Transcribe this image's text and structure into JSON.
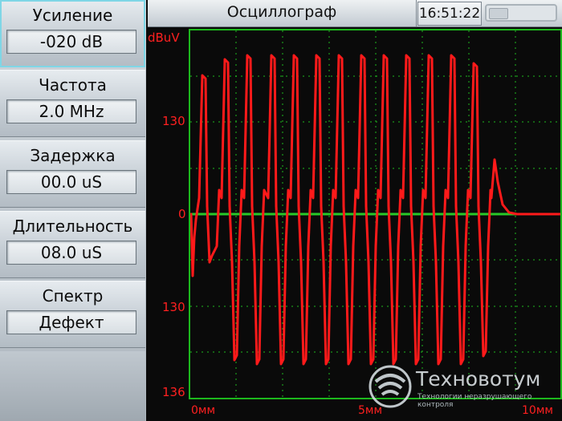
{
  "topbar": {
    "title": "Осциллограф",
    "time": "16:51:22",
    "battery_icon": "battery-icon"
  },
  "controls": [
    {
      "label": "Усиление",
      "value": "-020 dB",
      "active": true
    },
    {
      "label": "Частота",
      "value": "2.0 MHz",
      "active": false
    },
    {
      "label": "Задержка",
      "value": "00.0 uS",
      "active": false
    },
    {
      "label": "Длительность",
      "value": "08.0 uS",
      "active": false
    },
    {
      "label": "Спектр",
      "value": "Дефект",
      "active": false
    }
  ],
  "plot": {
    "y_unit": "dBuV",
    "y_ticks": [
      "130",
      "0",
      "130",
      "136"
    ],
    "x_ticks": [
      "0мм",
      "5мм",
      "10мм"
    ],
    "colors": {
      "grid": "#1db81d",
      "trace": "#ff1a1a",
      "baseline": "#28c828",
      "background": "#0a0a0a"
    }
  },
  "watermark": {
    "name": "Техновотум",
    "tagline": "Технологии неразрушающего контроля"
  }
}
